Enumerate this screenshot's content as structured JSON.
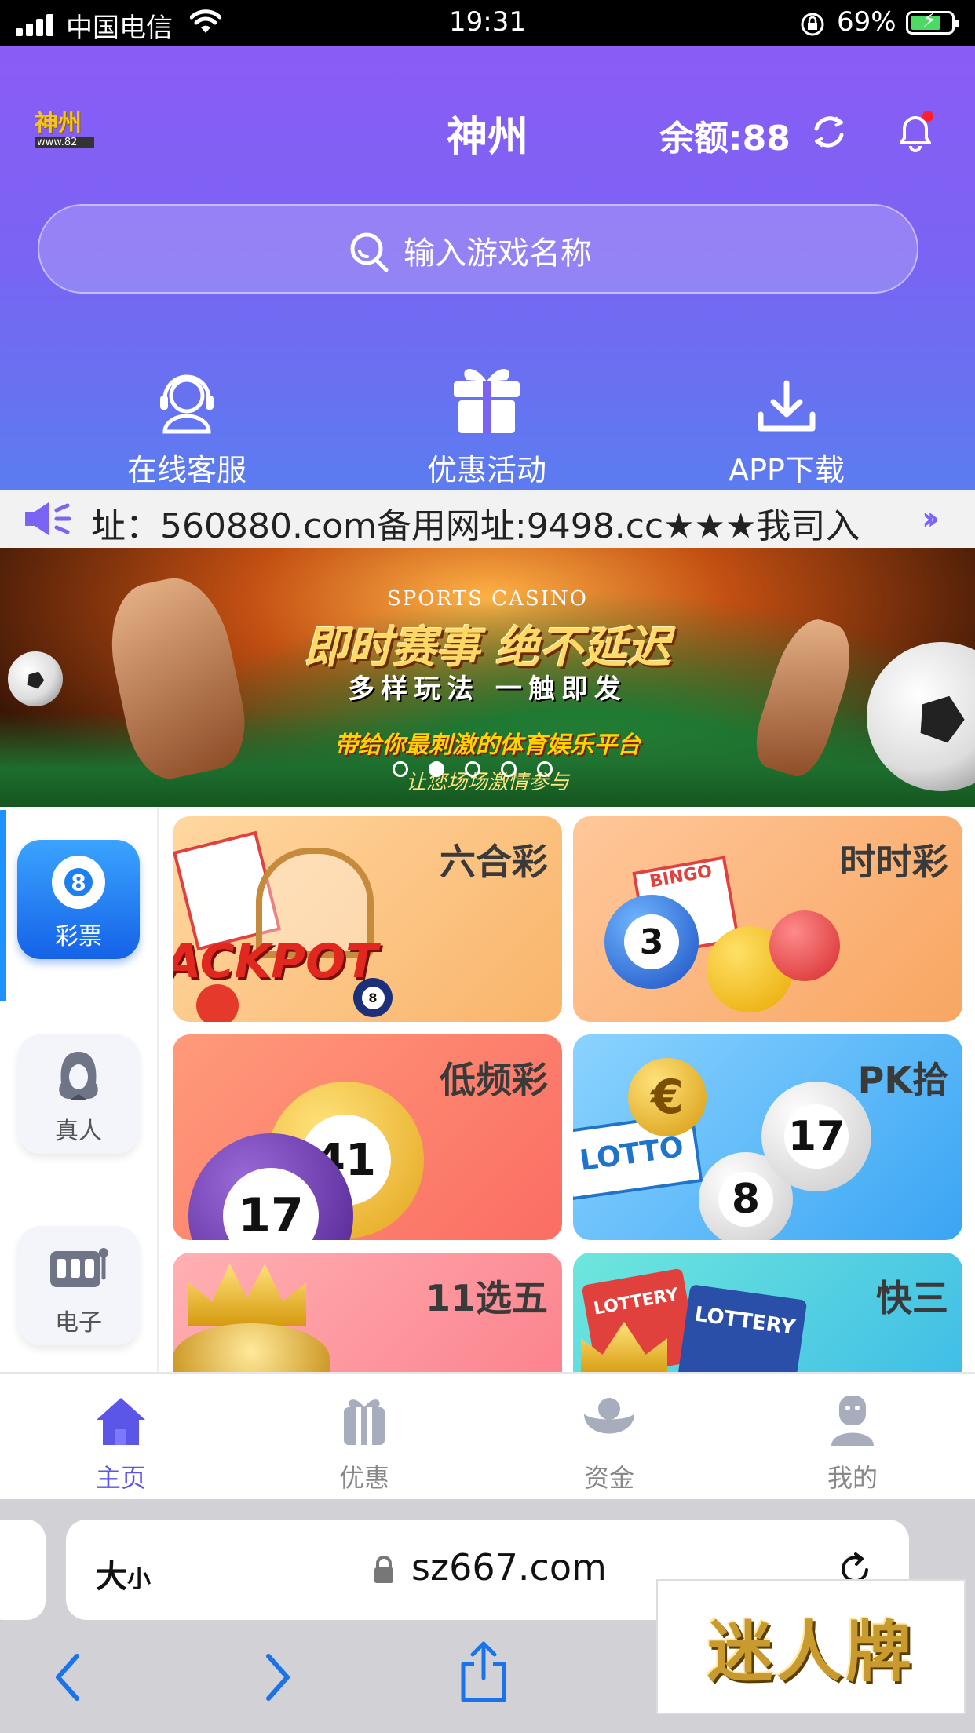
{
  "status_bar": {
    "carrier": "中国电信",
    "time": "19:31",
    "battery": "69%"
  },
  "header": {
    "logo_text": "神州",
    "logo_sub": "www.82",
    "title": "神州",
    "balance": "余额:88"
  },
  "search": {
    "placeholder": "输入游戏名称"
  },
  "quick_links": [
    {
      "label": "在线客服",
      "icon": "headset-icon"
    },
    {
      "label": "优惠活动",
      "icon": "gift-icon"
    },
    {
      "label": "APP下载",
      "icon": "download-icon"
    }
  ],
  "marquee": {
    "text": "址：560880.com备用网址:9498.cc★★★我司入"
  },
  "banner": {
    "tag": "SPORTS CASINO",
    "headline": "即时赛事 绝不延迟",
    "sub": "多样玩法 一触即发",
    "slogan": "带给你最刺激的体育娱乐平台",
    "slogan2": "让您场场激情参与",
    "active_dot": 1,
    "dot_count": 5
  },
  "categories": [
    {
      "label": "彩票",
      "icon": "lottery-ball-icon",
      "active": true
    },
    {
      "label": "真人",
      "icon": "live-dealer-icon",
      "active": false
    },
    {
      "label": "电子",
      "icon": "slot-machine-icon",
      "active": false
    }
  ],
  "games": [
    {
      "name": "六合彩"
    },
    {
      "name": "时时彩"
    },
    {
      "name": "低频彩"
    },
    {
      "name": "PK拾"
    },
    {
      "name": "11选五"
    },
    {
      "name": "快三"
    }
  ],
  "tile_decor": {
    "jackpot": "ACKPOT",
    "bingo": "BINGO",
    "lotto": "LOTTO",
    "lottery": "LOTTERY",
    "ball_3": "3",
    "ball_17": "17",
    "ball_41": "41",
    "ball_8": "8"
  },
  "tabbar": [
    {
      "label": "主页",
      "icon": "home-icon",
      "active": true
    },
    {
      "label": "优惠",
      "icon": "gift-box-icon",
      "active": false
    },
    {
      "label": "资金",
      "icon": "wallet-icon",
      "active": false
    },
    {
      "label": "我的",
      "icon": "user-icon",
      "active": false
    }
  ],
  "browser": {
    "text_size": "大",
    "text_size_small": "小",
    "url": "sz667.com"
  },
  "watermark": "迷人牌",
  "colors": {
    "accent": "#5b55e8",
    "header_top": "#8b5cf6",
    "header_bottom": "#5b7cf0",
    "rail_indicator": "#1e90ff"
  }
}
